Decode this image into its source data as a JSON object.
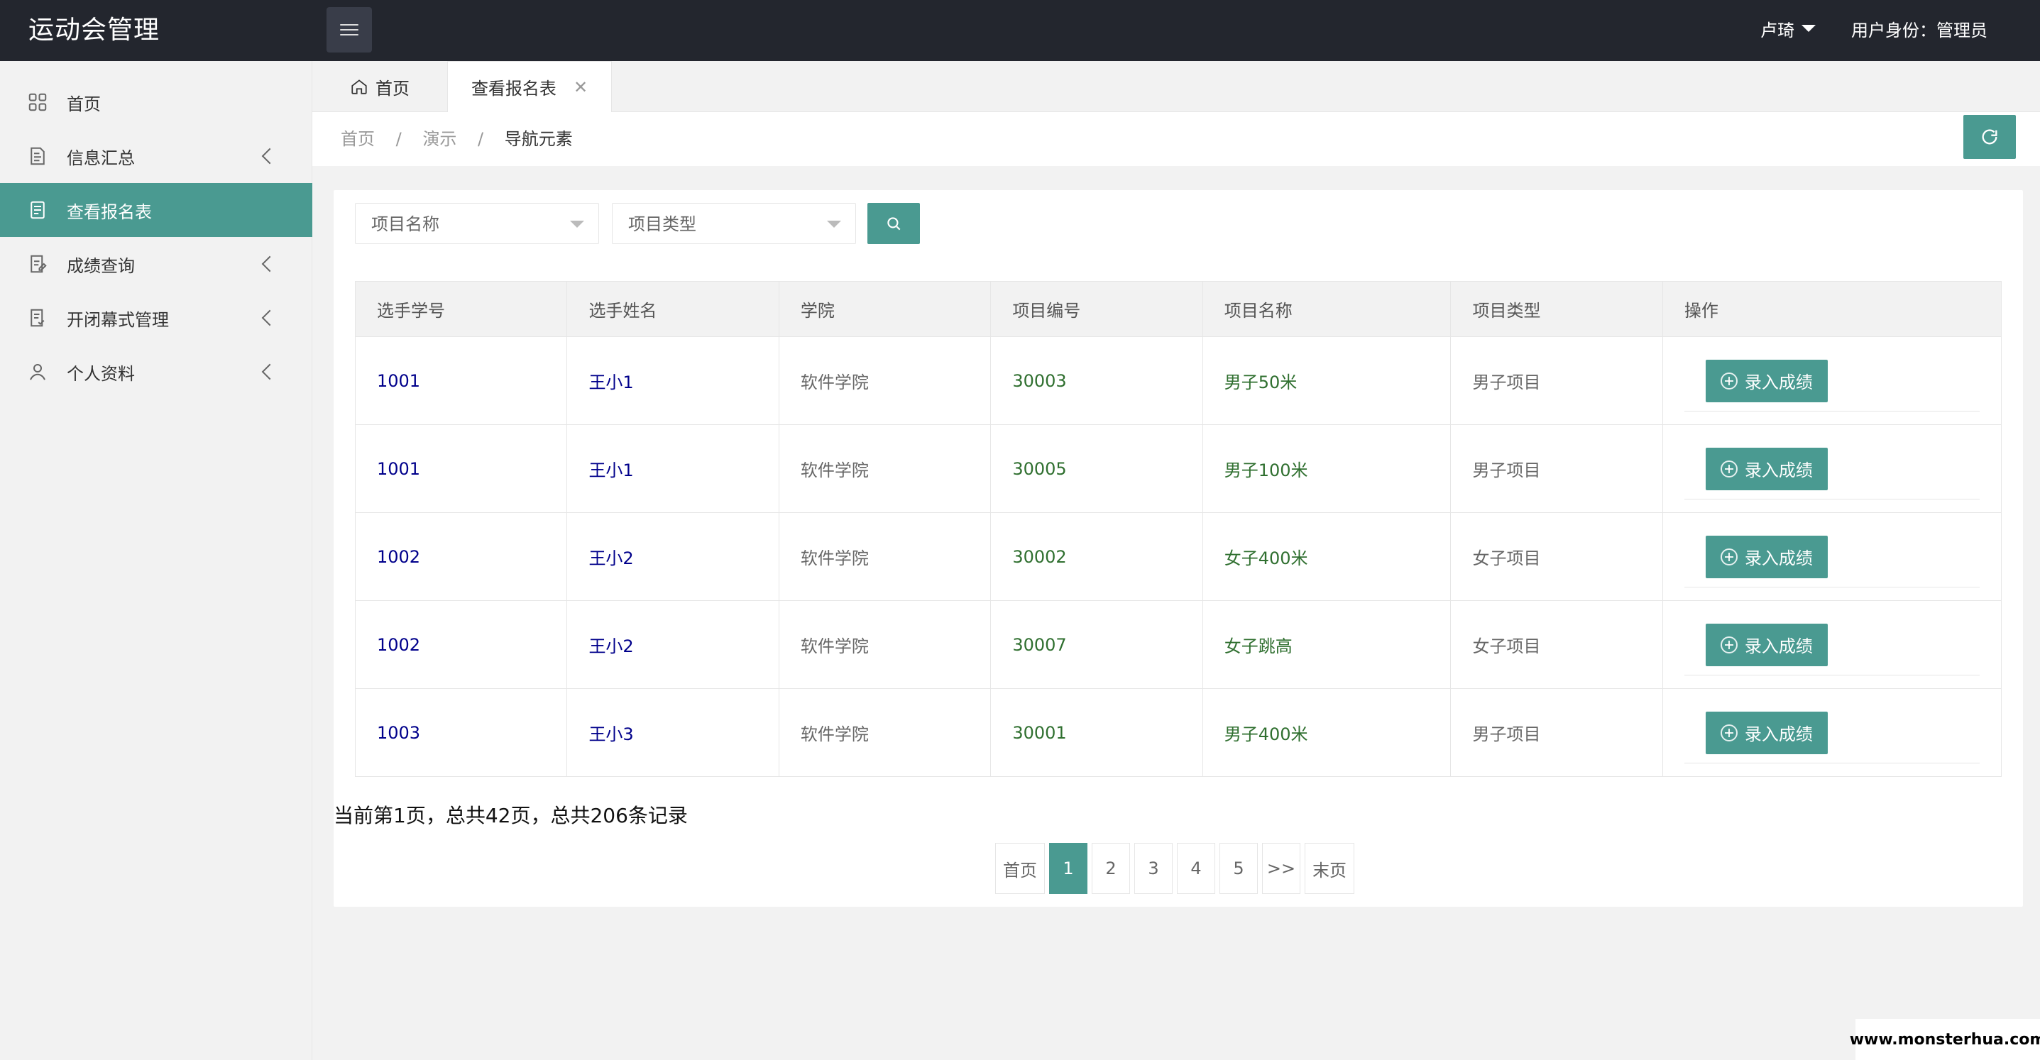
{
  "app": {
    "title": "运动会管理"
  },
  "header": {
    "user_name": "卢琦",
    "role_text": "用户身份：管理员"
  },
  "sidebar": {
    "items": [
      {
        "label": "首页",
        "icon": "dashboard-icon",
        "has_arrow": false,
        "active": false
      },
      {
        "label": "信息汇总",
        "icon": "document-icon",
        "has_arrow": true,
        "active": false
      },
      {
        "label": "查看报名表",
        "icon": "form-icon",
        "has_arrow": false,
        "active": true
      },
      {
        "label": "成绩查询",
        "icon": "edit-doc-icon",
        "has_arrow": true,
        "active": false
      },
      {
        "label": "开闭幕式管理",
        "icon": "check-doc-icon",
        "has_arrow": true,
        "active": false
      },
      {
        "label": "个人资料",
        "icon": "user-icon",
        "has_arrow": true,
        "active": false
      }
    ]
  },
  "tabs": {
    "home_label": "首页",
    "active_label": "查看报名表",
    "close_glyph": "✕"
  },
  "breadcrumb": {
    "items": [
      "首页",
      "演示",
      "导航元素"
    ],
    "separator": "/"
  },
  "filters": {
    "project_name_placeholder": "项目名称",
    "project_type_placeholder": "项目类型"
  },
  "table": {
    "headers": [
      "选手学号",
      "选手姓名",
      "学院",
      "项目编号",
      "项目名称",
      "项目类型",
      "操作"
    ],
    "rows": [
      {
        "student_id": "1001",
        "name": "王小1",
        "college": "软件学院",
        "project_id": "30003",
        "project_name": "男子50米",
        "project_type": "男子项目",
        "action": "录入成绩"
      },
      {
        "student_id": "1001",
        "name": "王小1",
        "college": "软件学院",
        "project_id": "30005",
        "project_name": "男子100米",
        "project_type": "男子项目",
        "action": "录入成绩"
      },
      {
        "student_id": "1002",
        "name": "王小2",
        "college": "软件学院",
        "project_id": "30002",
        "project_name": "女子400米",
        "project_type": "女子项目",
        "action": "录入成绩"
      },
      {
        "student_id": "1002",
        "name": "王小2",
        "college": "软件学院",
        "project_id": "30007",
        "project_name": "女子跳高",
        "project_type": "女子项目",
        "action": "录入成绩"
      },
      {
        "student_id": "1003",
        "name": "王小3",
        "college": "软件学院",
        "project_id": "30001",
        "project_name": "男子400米",
        "project_type": "男子项目",
        "action": "录入成绩"
      }
    ]
  },
  "summary": "当前第1页，总共42页，总共206条记录",
  "pagination": {
    "first": "首页",
    "pages": [
      "1",
      "2",
      "3",
      "4",
      "5"
    ],
    "current": "1",
    "next": ">>",
    "last": "末页"
  },
  "watermark": "www.monsterhua.com",
  "colors": {
    "accent": "#4a9a91",
    "header_bg": "#23262e",
    "link_blue": "#00008b",
    "text_green": "#2f6f2f"
  }
}
